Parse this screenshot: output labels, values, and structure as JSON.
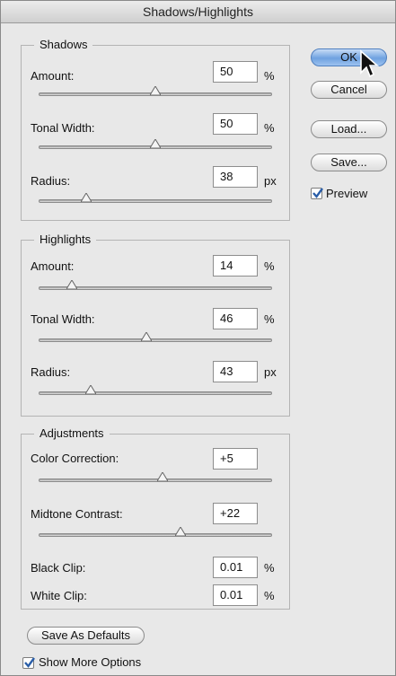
{
  "window": {
    "title": "Shadows/Highlights"
  },
  "shadows": {
    "title": "Shadows",
    "amount": {
      "label": "Amount:",
      "value": "50",
      "unit": "%",
      "slider": 0.5
    },
    "tonal_width": {
      "label": "Tonal Width:",
      "value": "50",
      "unit": "%",
      "slider": 0.5
    },
    "radius": {
      "label": "Radius:",
      "value": "38",
      "unit": "px",
      "slider": 0.2
    }
  },
  "highlights": {
    "title": "Highlights",
    "amount": {
      "label": "Amount:",
      "value": "14",
      "unit": "%",
      "slider": 0.14
    },
    "tonal_width": {
      "label": "Tonal Width:",
      "value": "46",
      "unit": "%",
      "slider": 0.46
    },
    "radius": {
      "label": "Radius:",
      "value": "43",
      "unit": "px",
      "slider": 0.22
    }
  },
  "adjustments": {
    "title": "Adjustments",
    "color_correction": {
      "label": "Color Correction:",
      "value": "+5",
      "slider": 0.53
    },
    "midtone_contrast": {
      "label": "Midtone Contrast:",
      "value": "+22",
      "slider": 0.61
    },
    "black_clip": {
      "label": "Black Clip:",
      "value": "0.01",
      "unit": "%"
    },
    "white_clip": {
      "label": "White Clip:",
      "value": "0.01",
      "unit": "%"
    }
  },
  "buttons": {
    "ok": "OK",
    "cancel": "Cancel",
    "load": "Load...",
    "save": "Save...",
    "save_defaults": "Save As Defaults"
  },
  "options": {
    "preview": {
      "label": "Preview",
      "checked": true
    },
    "show_more": {
      "label": "Show More Options",
      "checked": true
    }
  },
  "icons": {
    "cursor": "arrow-cursor-icon",
    "check": "checkmark-icon",
    "thumb": "slider-thumb-icon"
  },
  "colors": {
    "accent": "#6fa2e0",
    "check": "#2a5ea8"
  }
}
